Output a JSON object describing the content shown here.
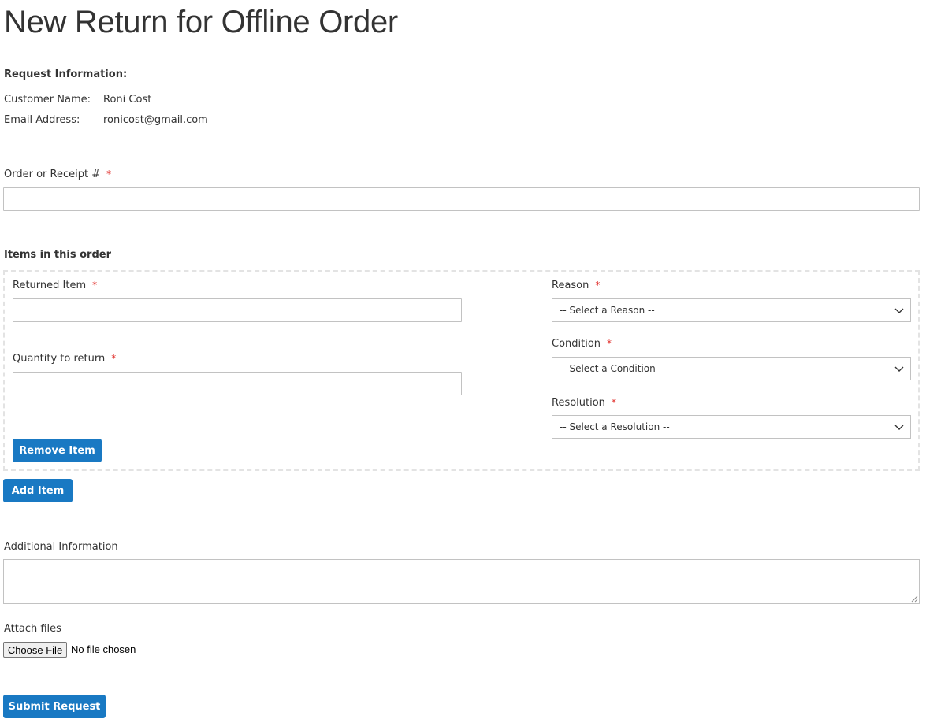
{
  "page": {
    "title": "New Return for Offline Order"
  },
  "request_info": {
    "heading": "Request Information:",
    "customer_name_label": "Customer Name:",
    "customer_name_value": "Roni Cost",
    "email_label": "Email Address:",
    "email_value": "ronicost@gmail.com"
  },
  "order": {
    "label": "Order or Receipt #",
    "required_mark": "*",
    "value": ""
  },
  "items": {
    "heading": "Items in this order",
    "returned_item_label": "Returned Item",
    "quantity_label": "Quantity to return",
    "reason_label": "Reason",
    "reason_placeholder": "-- Select a Reason --",
    "condition_label": "Condition",
    "condition_placeholder": "-- Select a Condition --",
    "resolution_label": "Resolution",
    "resolution_placeholder": "-- Select a Resolution --",
    "required_mark": "*",
    "remove_button": "Remove Item",
    "add_button": "Add Item"
  },
  "additional": {
    "label": "Additional Information",
    "value": ""
  },
  "attach": {
    "label": "Attach files",
    "choose_button": "Choose File",
    "status": "No file chosen"
  },
  "submit": {
    "label": "Submit Request"
  },
  "colors": {
    "accent": "#1979c3",
    "required": "#e02b27",
    "border": "#c2c2c2",
    "dashed_border": "#e3e3e3"
  },
  "icons": {
    "select_arrow": "chevron-down-icon",
    "textarea_resize": "resize-grip-icon"
  }
}
